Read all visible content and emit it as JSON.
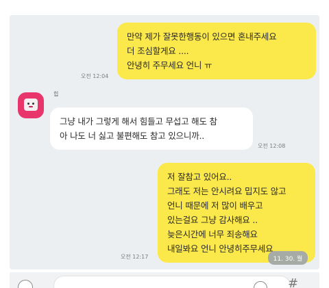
{
  "chat": {
    "messages": [
      {
        "sender": "me",
        "lines": [
          "만약 제가 잘못한행동이 있으면 혼내주세요",
          "더 조심할게요 ....",
          "안녕히 주무세요 언니 ㅠ"
        ],
        "time": "오전 12:04"
      },
      {
        "sender": "other",
        "sender_name": "힙",
        "lines": [
          "그냥 내가 그렇게 해서 힘들고 무섭고 해도 참",
          "아 나도 너 싫고 불편해도 참고 있으니까.."
        ],
        "time": "오전 12:08"
      },
      {
        "sender": "me",
        "lines": [
          "저 잘참고 있어요..",
          "그래도 저는 안시려요 밉지도 않고",
          "언니 때문에 저 많이 배우고",
          "있는걸요 그냥 감사해요 ..",
          "늦은시간에 너무 죄송해요",
          "내일봐요 언니 안녕히주무세요"
        ],
        "time": "오전 12:17"
      }
    ],
    "date_badge": "11. 30. 월"
  },
  "input_bar": {
    "plus_icon": "plus-icon",
    "emoji_icon": "emoji-icon",
    "hash_icon": "#"
  },
  "colors": {
    "my_bubble": "#fbe84a",
    "other_bubble": "#ffffff",
    "chat_background": "#eceff2",
    "avatar": "#e8356b"
  }
}
